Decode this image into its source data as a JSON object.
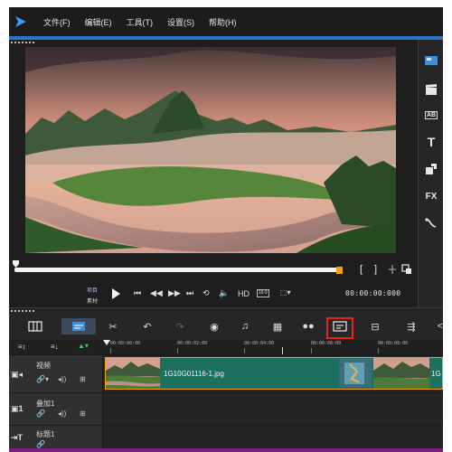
{
  "menu": [
    "文件(F)",
    "编辑(E)",
    "工具(T)",
    "设置(S)",
    "帮助(H)"
  ],
  "playback": {
    "project_label": "项目",
    "clip_label": "素材",
    "hd_label": "HD",
    "aspect_label": "16:9",
    "timecode": "00:00:00:000",
    "mark_in": "[",
    "mark_out": "]"
  },
  "library_toolbar": {
    "transition_label": "AB",
    "title_label": "T",
    "fx_label": "FX"
  },
  "ruler": {
    "labels": [
      "00:00:00:00",
      "00:00:02:00",
      "00:00:04:00",
      "00:00:06:00",
      "00:00:08:00"
    ]
  },
  "tracks": [
    {
      "name": "视频",
      "icon": "video-track-icon"
    },
    {
      "name": "叠加1",
      "icon": "overlay-track-icon"
    },
    {
      "name": "标题1",
      "icon": "title-track-icon"
    }
  ],
  "clip": {
    "file_name": "1G10G01116-1.jpg",
    "edge_label": "1G"
  },
  "colors": {
    "accent": "#2e73c9",
    "clip": "#1d6f5e",
    "clip_border": "#f0a21c",
    "highlight": "#e8221b",
    "bottom_strip": "#7a1f80"
  }
}
